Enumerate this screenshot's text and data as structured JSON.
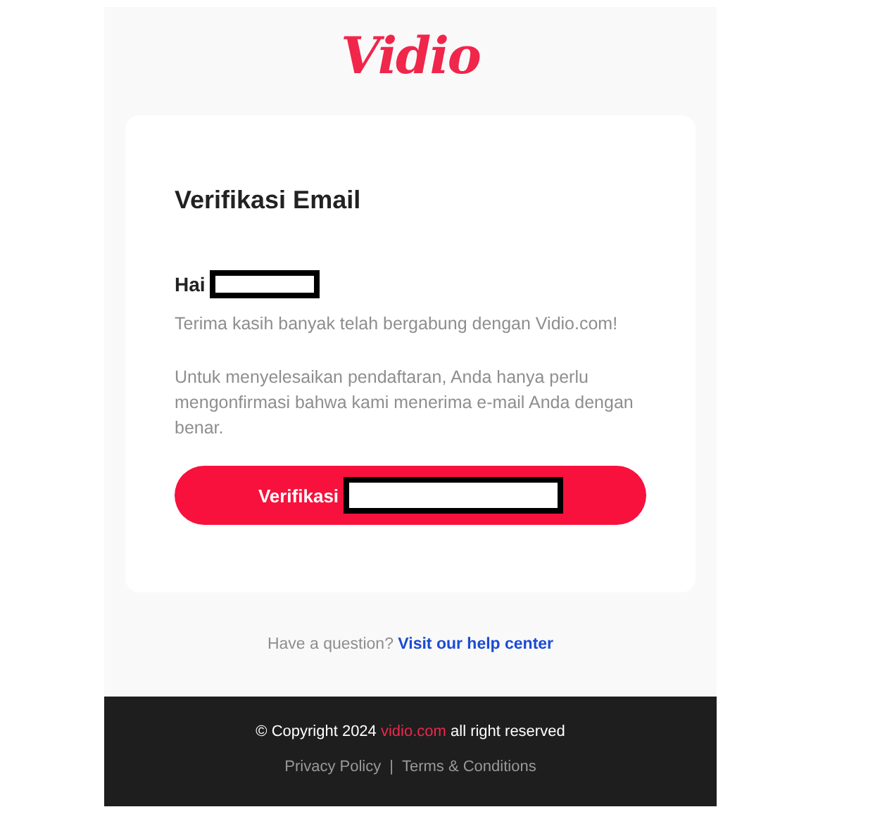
{
  "logo": {
    "text": "Vidio"
  },
  "card": {
    "title": "Verifikasi Email",
    "greeting": "Hai",
    "greeting_redacted": true,
    "paragraphs": [
      "Terima kasih banyak telah bergabung dengan Vidio.com!",
      "Untuk menyelesaikan pendaftaran, Anda hanya perlu mengonfirmasi bahwa kami menerima e-mail Anda dengan benar."
    ],
    "button": {
      "label": "Verifikasi",
      "redacted": true
    }
  },
  "help": {
    "text": "Have a question?",
    "link": "Visit our help center"
  },
  "footer": {
    "copyright_before": "© Copyright 2024",
    "copyright_link": "vidio.com",
    "copyright_after": "all right reserved",
    "links": [
      "Privacy Policy",
      "Terms & Conditions"
    ],
    "separator": "|"
  }
}
